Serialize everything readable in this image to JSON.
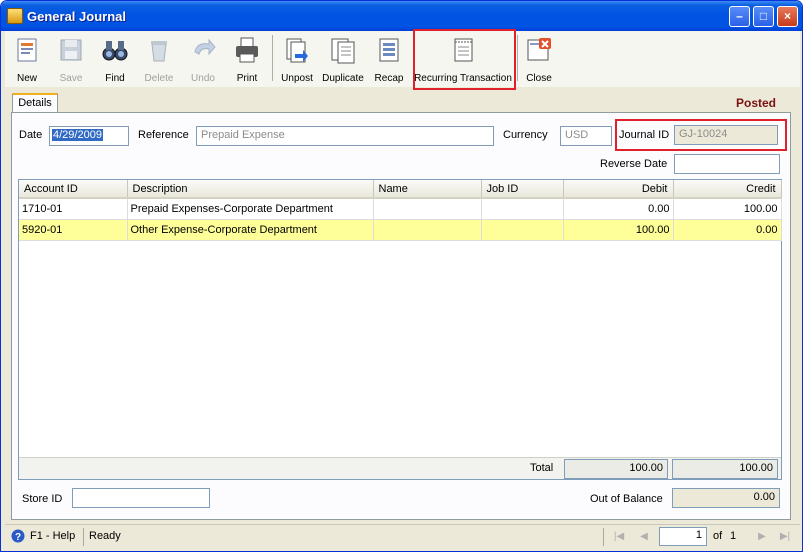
{
  "window": {
    "title": "General Journal"
  },
  "toolbar": {
    "new": "New",
    "save": "Save",
    "find": "Find",
    "delete": "Delete",
    "undo": "Undo",
    "print": "Print",
    "unpost": "Unpost",
    "duplicate": "Duplicate",
    "recap": "Recap",
    "recurring": "Recurring Transaction",
    "close": "Close"
  },
  "tab": {
    "details": "Details"
  },
  "status_label": "Posted",
  "form": {
    "date_label": "Date",
    "date_value": "4/29/2009",
    "reference_label": "Reference",
    "reference_value": "Prepaid Expense",
    "currency_label": "Currency",
    "currency_value": "USD",
    "journal_id_label": "Journal ID",
    "journal_id_value": "GJ-10024",
    "reverse_date_label": "Reverse Date",
    "reverse_date_value": ""
  },
  "grid": {
    "headers": {
      "account": "Account ID",
      "description": "Description",
      "name": "Name",
      "job": "Job ID",
      "debit": "Debit",
      "credit": "Credit"
    },
    "rows": [
      {
        "account": "1710-01",
        "description": "Prepaid Expenses-Corporate Department",
        "name": "",
        "job": "",
        "debit": "0.00",
        "credit": "100.00"
      },
      {
        "account": "5920-01",
        "description": "Other Expense-Corporate Department",
        "name": "",
        "job": "",
        "debit": "100.00",
        "credit": "0.00"
      }
    ],
    "total_label": "Total",
    "total_debit": "100.00",
    "total_credit": "100.00"
  },
  "footer": {
    "store_id_label": "Store ID",
    "store_id_value": "",
    "out_of_balance_label": "Out of Balance",
    "out_of_balance_value": "0.00"
  },
  "statusbar": {
    "help": "F1 - Help",
    "status": "Ready",
    "page": "1",
    "of_label": "of",
    "total_pages": "1"
  },
  "colors": {
    "title_bar": "#0054e3",
    "selected_row": "#ffff99",
    "highlight": "#e0202a",
    "posted": "#7a1212"
  }
}
